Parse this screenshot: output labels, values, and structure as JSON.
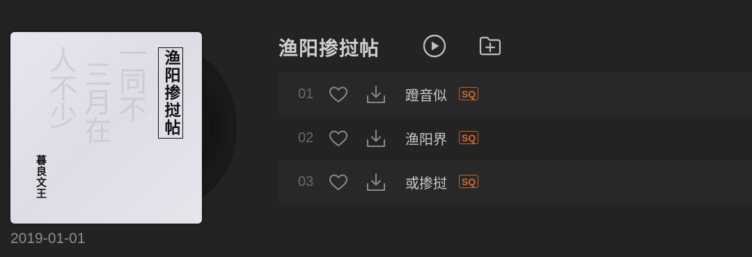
{
  "album": {
    "title": "渔阳掺挝帖",
    "cover_title": "渔阳掺挝帖",
    "cover_artist": "暮良文王",
    "release_date": "2019-01-01"
  },
  "icons": {
    "play": "play-circle-icon",
    "add": "folder-add-icon",
    "like": "heart-icon",
    "download": "download-icon"
  },
  "tracks": [
    {
      "number": "01",
      "name": "蹬音似",
      "quality": "SQ"
    },
    {
      "number": "02",
      "name": "渔阳界",
      "quality": "SQ"
    },
    {
      "number": "03",
      "name": "或掺挝",
      "quality": "SQ"
    }
  ],
  "colors": {
    "background": "#232323",
    "row_shade": "#282828",
    "sq_badge": "#d8692e",
    "title_text": "#cfcfcf"
  }
}
